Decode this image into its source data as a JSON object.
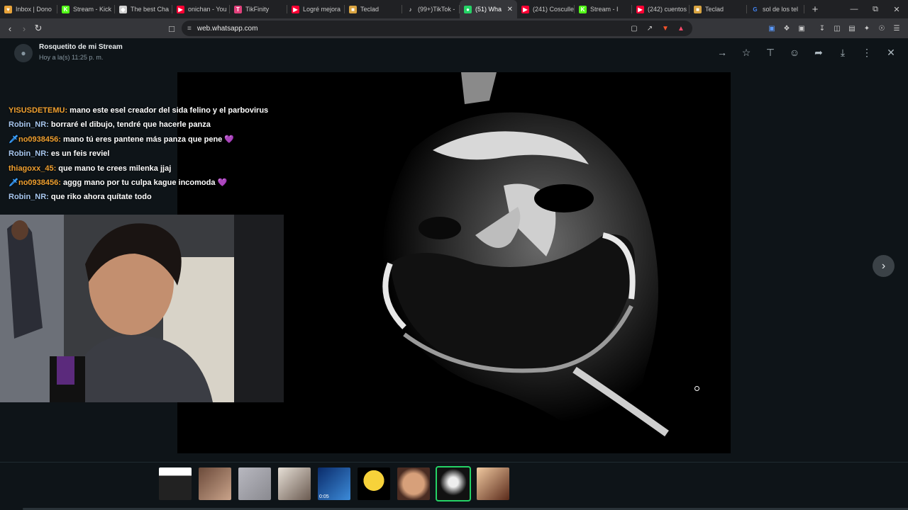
{
  "browser": {
    "tabs": [
      {
        "label": "Inbox | Dono",
        "icon": "donation-icon",
        "color": "#e8a33a"
      },
      {
        "label": "Stream - Kick",
        "icon": "kick-icon",
        "color": "#53fc18"
      },
      {
        "label": "The best Cha",
        "icon": "shield-icon",
        "color": "#d0d0d0"
      },
      {
        "label": "onichan - You",
        "icon": "youtube-icon",
        "color": "#ff0033"
      },
      {
        "label": "TikFinity",
        "icon": "tikfinity-icon",
        "color": "#e0407b"
      },
      {
        "label": "Logré mejora",
        "icon": "youtube-icon",
        "color": "#ff0033"
      },
      {
        "label": "Teclad",
        "icon": "page-icon",
        "color": "#d9a441"
      },
      {
        "label": "(99+)TikTok -",
        "icon": "tiktok-icon",
        "color": "#ffffff"
      },
      {
        "label": "(51) Wha",
        "icon": "whatsapp-icon",
        "color": "#25d366",
        "active": true
      },
      {
        "label": "(241) Cosculle",
        "icon": "youtube-icon",
        "color": "#ff0033"
      },
      {
        "label": "Stream - I",
        "icon": "kick-icon",
        "color": "#53fc18"
      },
      {
        "label": "(242) cuentos",
        "icon": "youtube-icon",
        "color": "#ff0033"
      },
      {
        "label": "Teclad",
        "icon": "page-icon",
        "color": "#d9a441"
      },
      {
        "label": "sol de los tel",
        "icon": "google-icon",
        "color": "#4285f4"
      }
    ],
    "url": "web.whatsapp.com"
  },
  "viewer": {
    "sender": "Rosquetito de mi Stream",
    "timestamp": "Hoy a la(s) 11:25 p. m.",
    "chat": [
      {
        "user": "YISUSDETEMU:",
        "text": " mano este esel creador del sida felino y el parbovirus",
        "color": "#f0a030",
        "badge": ""
      },
      {
        "user": "Robin_NR:",
        "text": " borraré el dibujo, tendré que hacerle panza",
        "color": "#a8c8f0",
        "badge": ""
      },
      {
        "user": "no0938456:",
        "text": " mano tú eres pantene más panza que pene 💜",
        "color": "#f0a030",
        "badge": "🗡"
      },
      {
        "user": "Robin_NR:",
        "text": " es un feis reviel",
        "color": "#a8c8f0",
        "badge": ""
      },
      {
        "user": "thiagoxx_45:",
        "text": " que mano te crees milenka jjaj",
        "color": "#f0a030",
        "badge": ""
      },
      {
        "user": "no0938456:",
        "text": " aggg mano por tu culpa kague incomoda 💜",
        "color": "#f0a030",
        "badge": "🗡"
      },
      {
        "user": "Robin_NR:",
        "text": " que riko ahora quítate todo",
        "color": "#a8c8f0",
        "badge": ""
      }
    ],
    "thumbnails": [
      {
        "kind": "stream-screen",
        "selected": false
      },
      {
        "kind": "photo-person",
        "selected": false
      },
      {
        "kind": "sketch",
        "selected": false
      },
      {
        "kind": "photo-couple",
        "selected": false
      },
      {
        "kind": "video",
        "duration": "0:05",
        "selected": false
      },
      {
        "kind": "cartoon",
        "selected": false
      },
      {
        "kind": "face-closeup",
        "selected": false
      },
      {
        "kind": "distorted-face",
        "selected": true
      },
      {
        "kind": "selfie",
        "selected": false
      }
    ]
  }
}
